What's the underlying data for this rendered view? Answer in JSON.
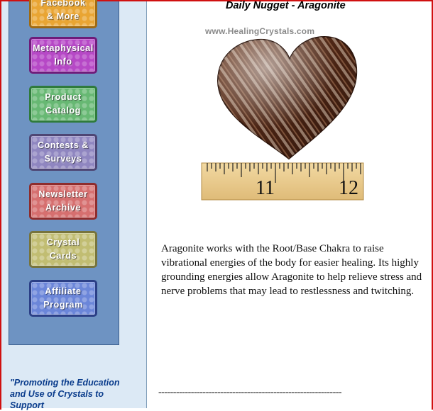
{
  "nav": {
    "buttons": [
      {
        "label": "Facebook\n& More",
        "color": "#e9a533"
      },
      {
        "label": "Metaphysical\nInfo",
        "color": "#b648c6"
      },
      {
        "label": "Product\nCatalog",
        "color": "#67b873"
      },
      {
        "label": "Contests &\nSurveys",
        "color": "#8f86c0"
      },
      {
        "label": "Newsletter\nArchive",
        "color": "#d66f6f"
      },
      {
        "label": "Crystal\nCards",
        "color": "#c1bd72"
      },
      {
        "label": "Affiliate\nProgram",
        "color": "#6b86d9"
      }
    ]
  },
  "tagline": "\"Promoting the Education and Use of Crystals to Support",
  "nugget": {
    "title": "Daily Nugget - Aragonite",
    "watermark": "www.HealingCrystals.com",
    "ruler_labels": [
      "11",
      "12"
    ],
    "description": "Aragonite works with the Root/Base Chakra to raise vibrational energies of the body for easier healing. Its highly grounding energies allow Aragonite to help relieve stress and nerve problems that may lead to restlessness and twitching.",
    "divider": "--------------------------------------------------------------"
  },
  "colors": {
    "frame_border": "#d01010",
    "nav_panel": "#6e93c2",
    "sidebar_bg": "#dce9f5",
    "tagline": "#0a3c8c"
  }
}
